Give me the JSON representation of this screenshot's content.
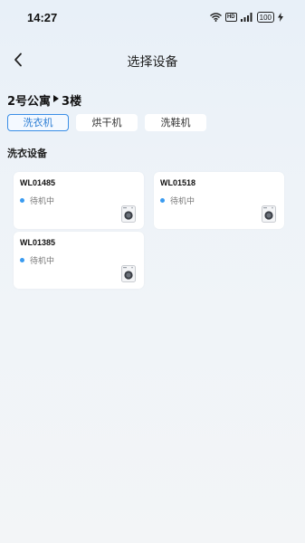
{
  "status_bar": {
    "time": "14:27",
    "hd": "HD",
    "battery": "100",
    "icons": [
      "wifi-icon",
      "signal-icon",
      "charging-icon"
    ]
  },
  "nav": {
    "back_icon": "chevron-left-icon",
    "title": "选择设备"
  },
  "location": {
    "building": "2号公寓",
    "separator_icon": "triangle-right-icon",
    "floor": "3楼"
  },
  "tabs": [
    {
      "label": "洗衣机",
      "active": true
    },
    {
      "label": "烘干机",
      "active": false
    },
    {
      "label": "洗鞋机",
      "active": false
    }
  ],
  "section": {
    "title": "洗衣设备"
  },
  "devices": [
    {
      "id": "WL01485",
      "status": "待机中",
      "icon": "washing-machine-icon"
    },
    {
      "id": "WL01518",
      "status": "待机中",
      "icon": "washing-machine-icon"
    },
    {
      "id": "WL01385",
      "status": "待机中",
      "icon": "washing-machine-icon"
    }
  ],
  "colors": {
    "accent": "#3a8ee6",
    "status_dot": "#3a9bf0"
  }
}
